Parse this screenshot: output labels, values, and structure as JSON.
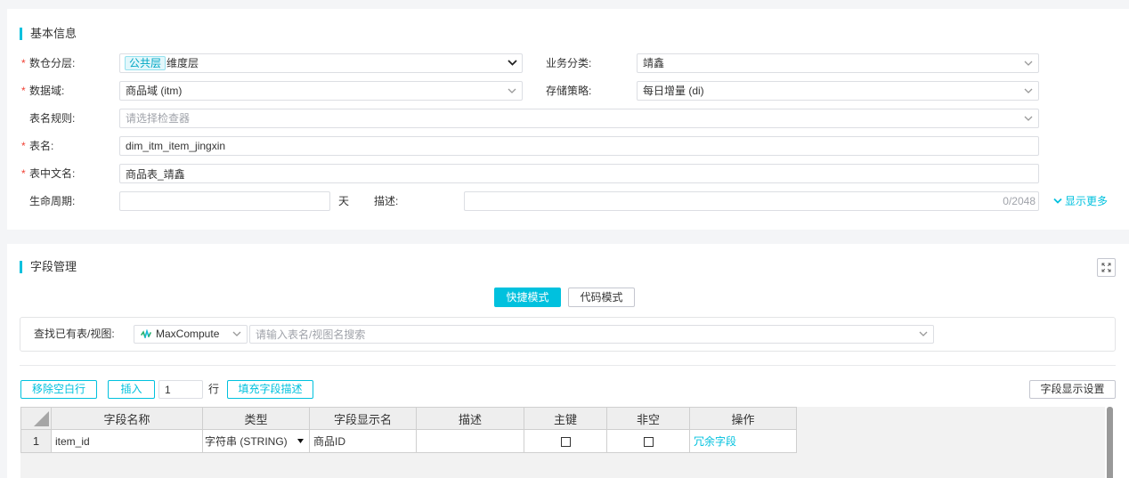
{
  "colors": {
    "accent": "#00c1de",
    "required": "#f04134",
    "link": "#00c1de"
  },
  "icons": {
    "select_arrow": "chevron-down-icon",
    "show_more": "chevron-down-icon",
    "expand": "fullscreen-expand-icon",
    "engine": "maxcompute-icon",
    "type_dropdown": "caret-down-icon",
    "corner": "select-all-triangle-icon"
  },
  "basic_info": {
    "title": "基本信息",
    "required_mark": "*",
    "layer": {
      "label": "数仓分层:",
      "required": true,
      "tag": "公共层",
      "value": "维度层"
    },
    "biz_category": {
      "label": "业务分类:",
      "value": "靖鑫"
    },
    "domain": {
      "label": "数据域:",
      "required": true,
      "value": "商品域 (itm)"
    },
    "storage_policy": {
      "label": "存储策略:",
      "value": "每日增量 (di)"
    },
    "name_rule": {
      "label": "表名规则:",
      "placeholder": "请选择检查器"
    },
    "table_name": {
      "label": "表名:",
      "required": true,
      "value": "dim_itm_item_jingxin"
    },
    "table_cn_name": {
      "label": "表中文名:",
      "required": true,
      "value": "商品表_靖鑫"
    },
    "lifecycle": {
      "label": "生命周期:",
      "value": "",
      "unit": "天"
    },
    "description": {
      "label": "描述:",
      "value": "",
      "counter": "0/2048"
    },
    "show_more": "显示更多"
  },
  "field_mgmt": {
    "title": "字段管理",
    "modes": [
      {
        "label": "快捷模式",
        "active": true
      },
      {
        "label": "代码模式",
        "active": false
      }
    ],
    "search": {
      "label": "查找已有表/视图:",
      "engine": "MaxCompute",
      "placeholder": "请输入表名/视图名搜索"
    },
    "toolbar": {
      "remove_blank": "移除空白行",
      "insert": "插入",
      "insert_count": "1",
      "rows_unit": "行",
      "fill_desc": "填充字段描述",
      "display_settings": "字段显示设置"
    },
    "table": {
      "columns": [
        "字段名称",
        "类型",
        "字段显示名",
        "描述",
        "主键",
        "非空",
        "操作"
      ],
      "rows": [
        {
          "index": "1",
          "name": "item_id",
          "type": "字符串 (STRING)",
          "display_name": "商品ID",
          "description": "",
          "primary_key": false,
          "not_null": false,
          "action": "冗余字段"
        }
      ]
    }
  }
}
